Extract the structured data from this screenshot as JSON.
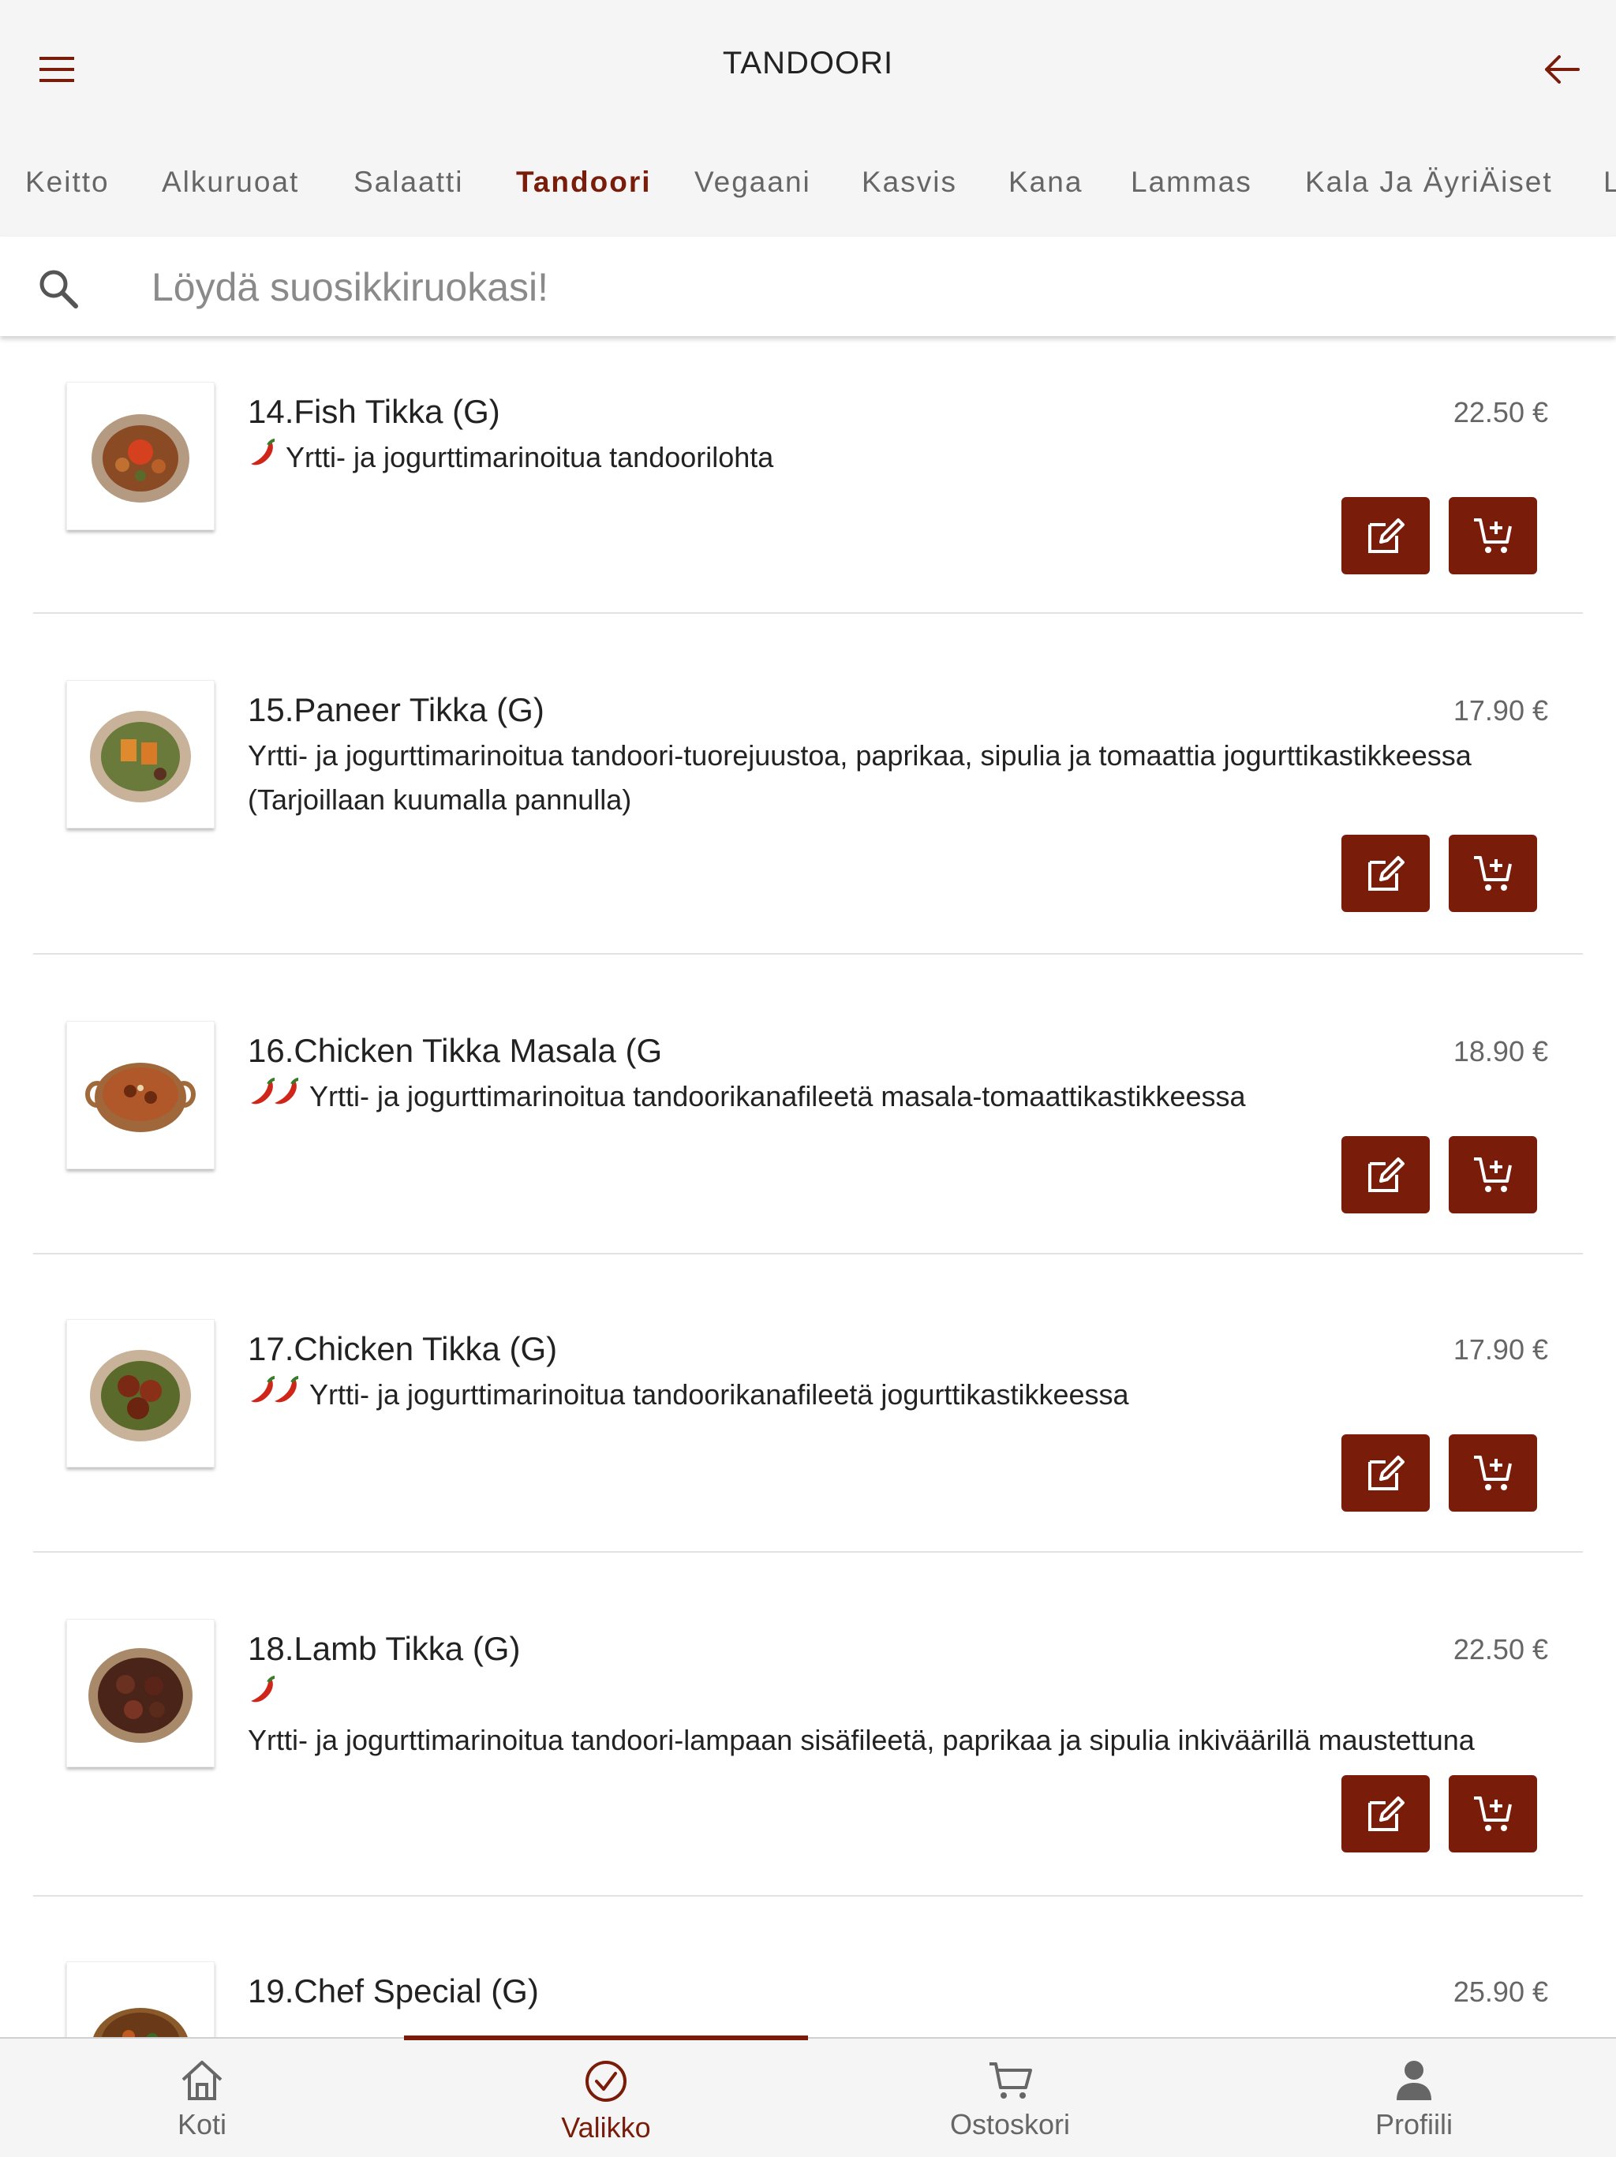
{
  "header": {
    "title": "TANDOORI"
  },
  "categories": [
    "Keitto",
    "Alkuruoat",
    "Salaatti",
    "Tandoori",
    "Vegaani",
    "Kasvis",
    "Kana",
    "Lammas",
    "Kala Ja ÄyriÄiset",
    "L"
  ],
  "active_category": "Tandoori",
  "search": {
    "placeholder": "Löydä suosikkiruokasi!"
  },
  "items": [
    {
      "name": "14.Fish Tikka (G)",
      "price": "22.50 €",
      "spice": 1,
      "description": "Yrtti- ja jogurttimarinoitua tandoorilohta"
    },
    {
      "name": "15.Paneer Tikka (G)",
      "price": "17.90 €",
      "spice": 0,
      "description": "Yrtti- ja jogurttimarinoitua tandoori-tuorejuustoa, paprikaa, sipulia ja tomaattia jogurttikastikkeessa (Tarjoillaan kuumalla pannulla)"
    },
    {
      "name": "16.Chicken Tikka Masala (G",
      "price": "18.90 €",
      "spice": 2,
      "description": "Yrtti- ja jogurttimarinoitua tandoorikanafileetä masala-tomaattikastikkeessa"
    },
    {
      "name": "17.Chicken Tikka (G)",
      "price": "17.90 €",
      "spice": 2,
      "description": "Yrtti- ja jogurttimarinoitua tandoorikanafileetä jogurttikastikkeessa"
    },
    {
      "name": "18.Lamb Tikka (G)",
      "price": "22.50 €",
      "spice": 1,
      "description": "Yrtti- ja jogurttimarinoitua tandoori-lampaan sisäfileetä, paprikaa ja sipulia inkiväärillä maustettuna"
    },
    {
      "name": "19.Chef Special (G)",
      "price": "25.90 €",
      "spice": 0,
      "description": ""
    }
  ],
  "bottom_nav": [
    {
      "label": "Koti",
      "icon": "home-icon"
    },
    {
      "label": "Valikko",
      "icon": "check-circle-icon"
    },
    {
      "label": "Ostoskori",
      "icon": "cart-icon"
    },
    {
      "label": "Profiili",
      "icon": "person-icon"
    }
  ],
  "active_nav": "Valikko",
  "colors": {
    "accent": "#7a1c0a",
    "bar_background": "#f5f5f5",
    "muted_text": "#666666"
  }
}
